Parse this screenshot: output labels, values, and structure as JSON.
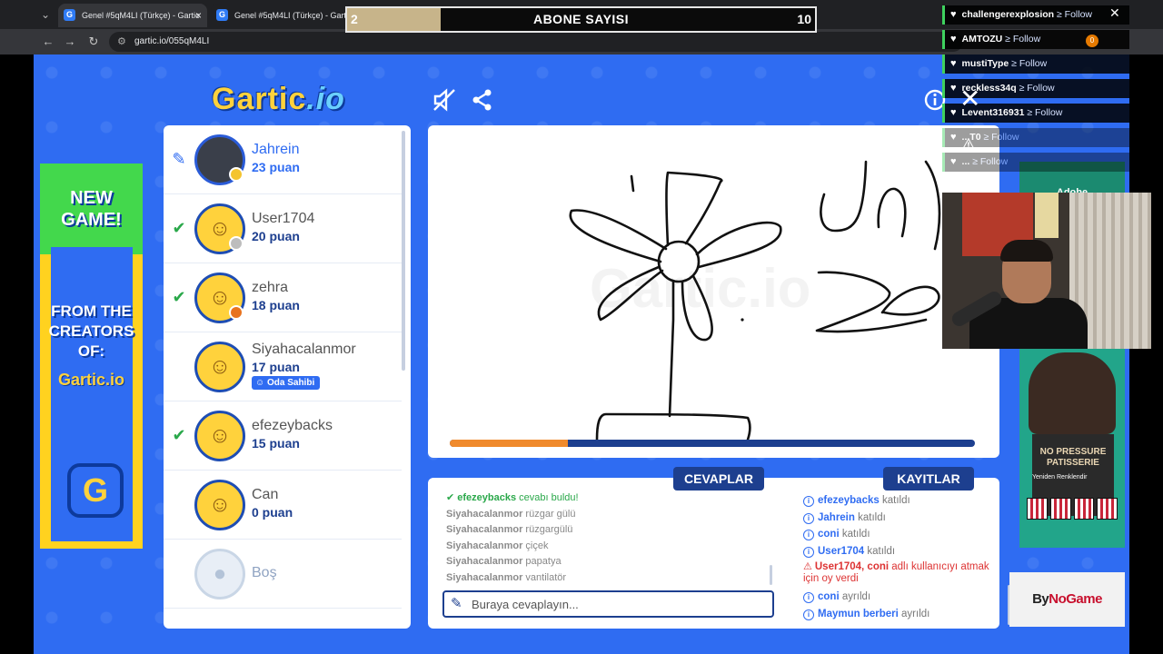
{
  "browser": {
    "tabs": [
      {
        "title": "Genel #5qM4LI (Türkçe) - Gartic",
        "favicon": "G"
      },
      {
        "title": "Genel #5qM4LI (Türkçe) - Gartic",
        "favicon": "G"
      }
    ],
    "url": "gartic.io/055qM4LI"
  },
  "subscriber_bar": {
    "title": "ABONE SAYISI",
    "current": "2",
    "goal": "10",
    "progress_percent": 20
  },
  "game": {
    "logo_main": "Gartic",
    "logo_suffix": ".io",
    "header_icons": [
      "mute-icon",
      "share-icon",
      "info-icon"
    ],
    "players": [
      {
        "name": "Jahrein",
        "score": "23 puan",
        "mark": "pen",
        "status_color": "#f4c430",
        "is_me": true
      },
      {
        "name": "User1704",
        "score": "20 puan",
        "mark": "check",
        "status_color": "#bdbdbd"
      },
      {
        "name": "zehra",
        "score": "18 puan",
        "mark": "check",
        "status_color": "#e8731f"
      },
      {
        "name": "Siyahacalanmor",
        "score": "17 puan",
        "mark": "",
        "badge": "Oda Sahibi"
      },
      {
        "name": "efezeybacks",
        "score": "15 puan",
        "mark": "check"
      },
      {
        "name": "Can",
        "score": "0 puan",
        "mark": ""
      },
      {
        "name": "Boş",
        "score": "",
        "mark": "",
        "empty": true
      }
    ],
    "timer_progress": 0.225,
    "answers_tab": "CEVAPLAR",
    "records_tab": "KAYITLAR",
    "answers": [
      {
        "user": "efezeybacks",
        "text": "cevabı buldu!",
        "correct": true
      },
      {
        "user": "Siyahacalanmor",
        "text": "rüzgar gülü"
      },
      {
        "user": "Siyahacalanmor",
        "text": "rüzgargülü"
      },
      {
        "user": "Siyahacalanmor",
        "text": "çiçek"
      },
      {
        "user": "Siyahacalanmor",
        "text": "papatya"
      },
      {
        "user": "Siyahacalanmor",
        "text": "vantilatör"
      }
    ],
    "answer_placeholder": "Buraya cevaplayın...",
    "records": [
      {
        "user": "efezeybacks",
        "text": "katıldı"
      },
      {
        "user": "Jahrein",
        "text": "katıldı"
      },
      {
        "user": "coni",
        "text": "katıldı"
      },
      {
        "user": "User1704",
        "text": "katıldı"
      },
      {
        "user": "User1704, coni",
        "text": "adlı kullanıcıyı atmak için oy verdi",
        "warning": true
      },
      {
        "user": "coni",
        "text": "ayrıldı"
      },
      {
        "user": "Maymun berberi",
        "text": "ayrıldı"
      }
    ],
    "ad_left": {
      "line1": "NEW",
      "line2": "GAME!",
      "line3": "FROM THE",
      "line4": "CREATORS",
      "line5": "OF:",
      "logo": "Gartic.io",
      "icon_letter": "G"
    },
    "ad_right": {
      "brand": "Adobe",
      "book_title": "NO PRESSURE PATISSERIE",
      "caption": "Yeniden Renklendir"
    }
  },
  "overlay": {
    "follows": [
      {
        "user": "challengerexplosion",
        "action": "Follow"
      },
      {
        "user": "AMTOZU",
        "action": "Follow"
      },
      {
        "user": "mustiType",
        "action": "Follow"
      },
      {
        "user": "reckless34q",
        "action": "Follow"
      },
      {
        "user": "Levent316931",
        "action": "Follow"
      },
      {
        "user": "...T0",
        "action": "Follow"
      },
      {
        "user": "...",
        "action": "Follow"
      }
    ],
    "extension_badge": "0",
    "sponsor": {
      "prefix": "By",
      "brand": "NoGame"
    }
  },
  "colors": {
    "game_blue": "#2f6cf2",
    "navy": "#1d3f8f",
    "correct_green": "#2aa84a",
    "timer_orange": "#f08a2c"
  }
}
